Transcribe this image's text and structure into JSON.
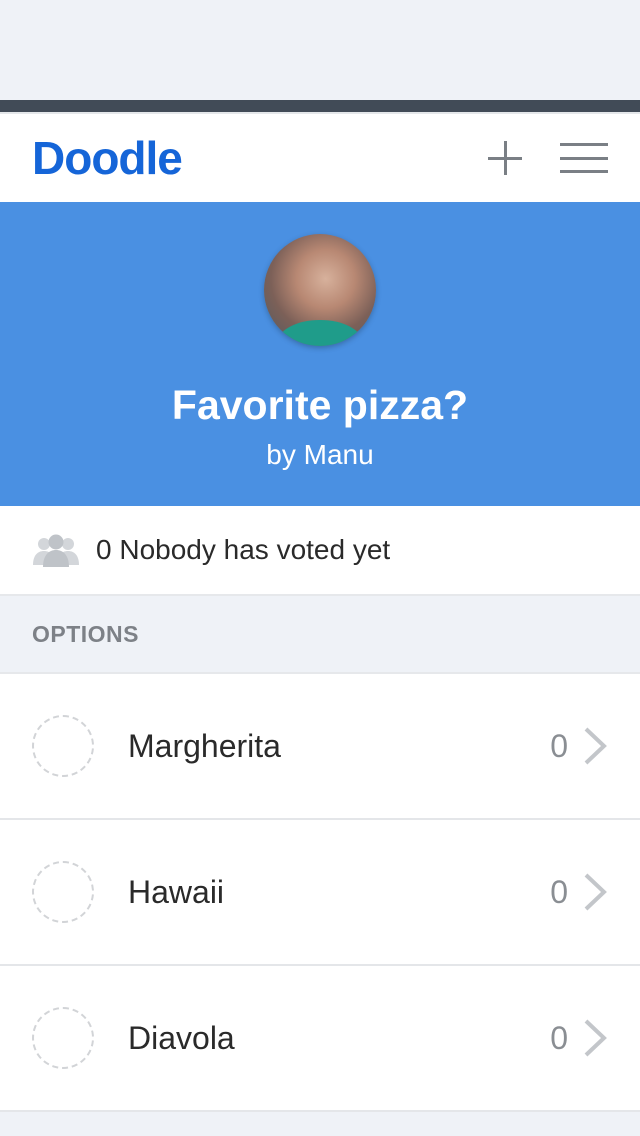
{
  "header": {
    "logo": "Doodle",
    "add_icon": "plus-icon",
    "menu_icon": "hamburger-menu-icon"
  },
  "poll": {
    "title": "Favorite pizza?",
    "author": "by Manu"
  },
  "votes": {
    "text": "0 Nobody has voted yet",
    "icon": "people-icon"
  },
  "options_section": {
    "label": "OPTIONS",
    "items": [
      {
        "label": "Margherita",
        "count": "0"
      },
      {
        "label": "Hawaii",
        "count": "0"
      },
      {
        "label": "Diavola",
        "count": "0"
      }
    ]
  },
  "colors": {
    "brand": "#1565d8",
    "hero_bg": "#4a90e2",
    "dark_bar": "#414b57"
  }
}
